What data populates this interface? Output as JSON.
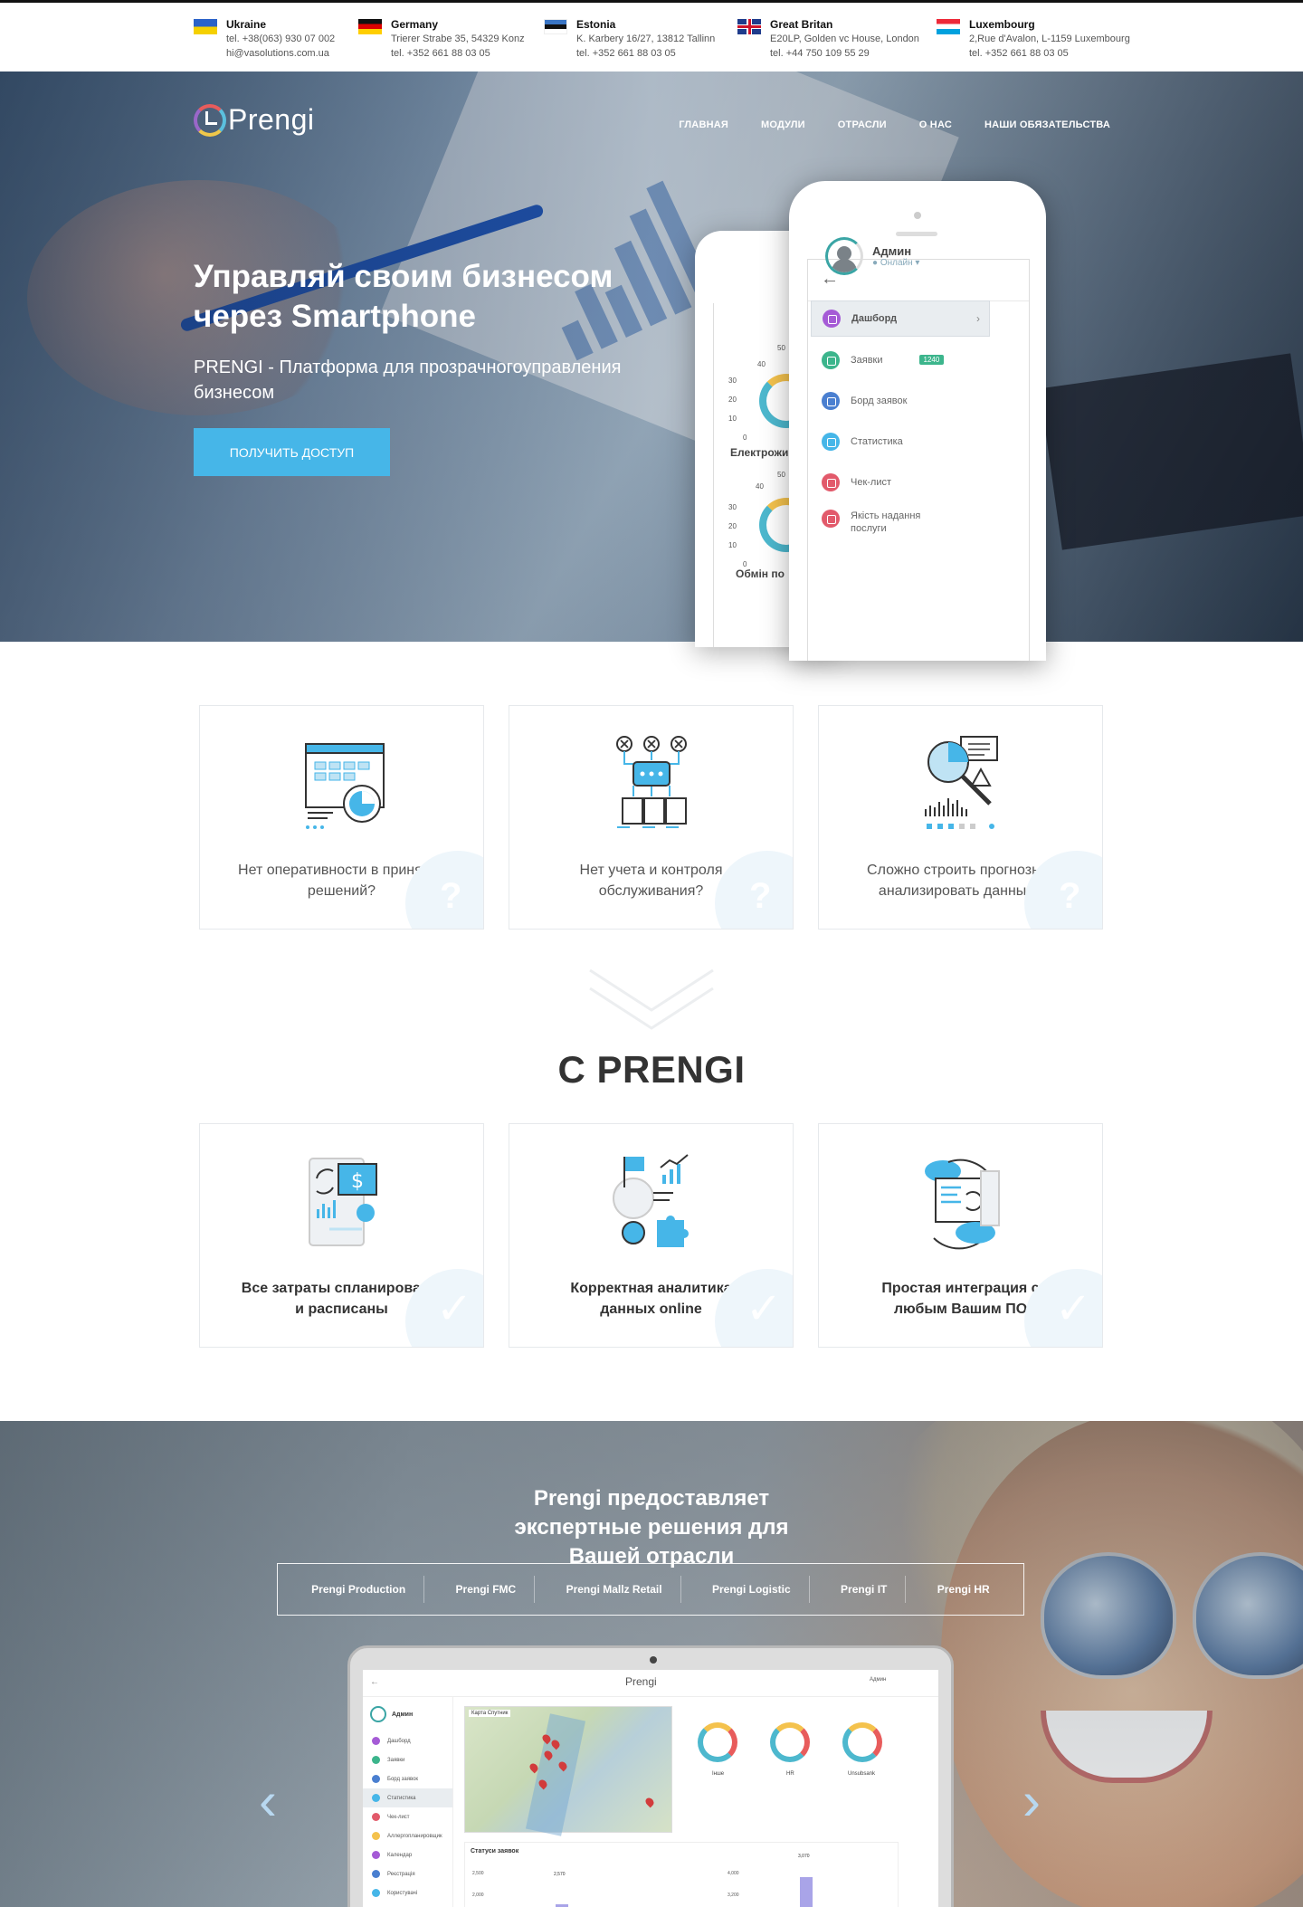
{
  "offices": [
    {
      "country": "Ukraine",
      "line1": "tel. +38(063) 930 07 002",
      "line2": "hi@vasolutions.com.ua",
      "flag": "ukraine"
    },
    {
      "country": "Germany",
      "line1": "Trierer Strabe 35, 54329 Konz",
      "line2": "tel. +352 661 88 03 05",
      "flag": "germany"
    },
    {
      "country": "Estonia",
      "line1": "K. Karbery 16/27, 13812 Tallinn",
      "line2": "tel. +352 661 88 03 05",
      "flag": "estonia"
    },
    {
      "country": "Great Britan",
      "line1": "E20LP, Golden vc House, London",
      "line2": "tel. +44 750 109 55 29",
      "flag": "uk"
    },
    {
      "country": "Luxembourg",
      "line1": "2,Rue d'Avalon, L-1159 Luxembourg",
      "line2": "tel. +352 661 88 03 05",
      "flag": "luxembourg"
    }
  ],
  "logo": {
    "text": "Prengi"
  },
  "nav": [
    "ГЛАВНАЯ",
    "МОДУЛИ",
    "ОТРАСЛИ",
    "О НАС",
    "НАШИ ОБЯЗАТЕЛЬСТВА"
  ],
  "hero": {
    "title": "Управляй своим бизнесом через Smartphone",
    "subtitle": "PRENGI - Платформа для прозрачногоуправления бизнесом",
    "cta": "ПОЛУЧИТЬ ДОСТУП"
  },
  "phone_back": {
    "gauges": [
      {
        "label": "Електрожи",
        "ticks": [
          "50",
          "40",
          "30",
          "20",
          "10",
          "0"
        ]
      },
      {
        "label": "Обмін по",
        "ticks": [
          "50",
          "40",
          "30",
          "20",
          "10",
          "0"
        ]
      }
    ]
  },
  "phone": {
    "user_name": "Админ",
    "user_status": "● Онлайн ▾",
    "menu": [
      {
        "label": "Дашборд",
        "color": "#a55bd6",
        "active": true
      },
      {
        "label": "Заявки",
        "color": "#3cb58c",
        "badge": "1240"
      },
      {
        "label": "Борд заявок",
        "color": "#4a7fd0"
      },
      {
        "label": "Статистика",
        "color": "#46b6e8"
      },
      {
        "label": "Чек-лист",
        "color": "#e25a6b"
      },
      {
        "label": "Якість надання послуги",
        "color": "#e25a6b"
      }
    ]
  },
  "problems": [
    {
      "text": "Нет оперативности в принятии решений?"
    },
    {
      "text": "Нет учета и контроля обслуживания?"
    },
    {
      "text": "Сложно строить прогнозы и анализировать данные?"
    }
  ],
  "with_title": "С PRENGI",
  "solutions": [
    {
      "text": "Все затраты спланированы и расписаны"
    },
    {
      "text": "Корректная аналитика данных online"
    },
    {
      "text": "Простая интеграция с любым Вашим ПО"
    }
  ],
  "industries": {
    "title": "Prengi предоставляет экспертные решения для Вашей отрасли",
    "tabs": [
      "Prengi Production",
      "Prengi FMC",
      "Prengi Mallz Retail",
      "Prengi Logistic",
      "Prengi IT",
      "Prengi HR"
    ],
    "prev": "‹",
    "next": "›"
  },
  "laptop": {
    "logo": "Prengi",
    "user": "Админ",
    "menu": [
      "Дашборд",
      "Заявки",
      "Борд заявок",
      "Статистика",
      "Чек-лист",
      "Аллергопланировщик",
      "Календар",
      "Реєстрація",
      "Користувачі"
    ],
    "menu_colors": [
      "#a55bd6",
      "#3cb58c",
      "#4a7fd0",
      "#46b6e8",
      "#e25a6b",
      "#f4c24d",
      "#a55bd6",
      "#4a7fd0",
      "#46b6e8"
    ],
    "map_tabs": "Карта  Спутник",
    "gauges": [
      "Інше",
      "HR",
      "Unsubsank"
    ],
    "chart_title": "Статуси заявок",
    "chart_labels": [
      "2,500",
      "2,000",
      "4,000",
      "3,200",
      "3,070",
      "2,570"
    ]
  }
}
